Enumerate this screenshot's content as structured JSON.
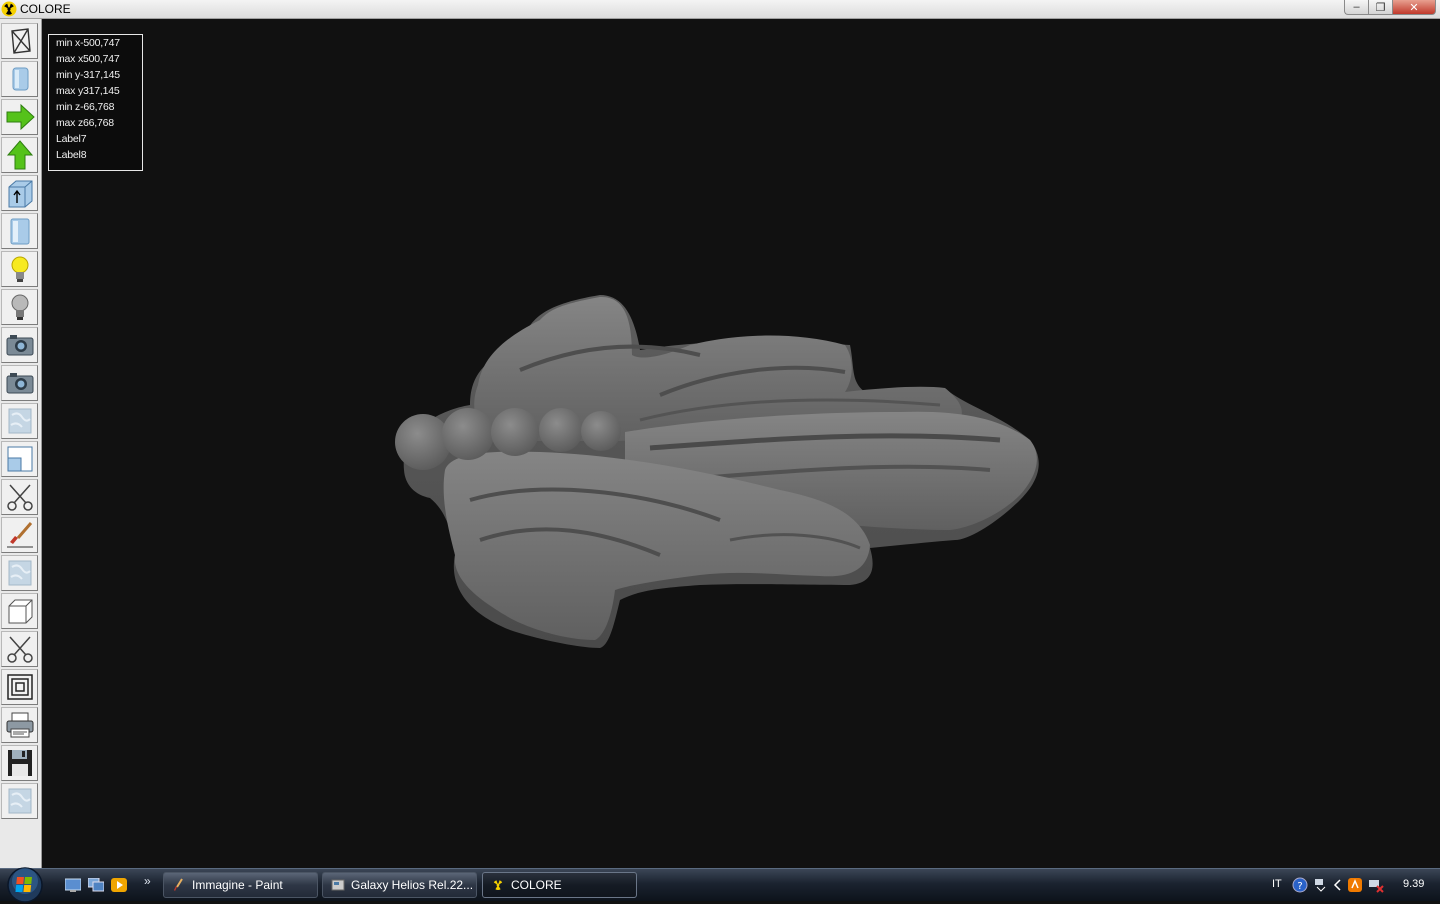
{
  "window": {
    "title": "COLORE",
    "controls": {
      "minimize": "‒",
      "maximize": "❐",
      "close": "✕"
    }
  },
  "toolbar": {
    "buttons": [
      {
        "icon": "wireframe-box-icon"
      },
      {
        "icon": "cylinder-icon"
      },
      {
        "icon": "green-arrow-right-icon"
      },
      {
        "icon": "green-arrow-up-icon"
      },
      {
        "icon": "cube-arrow-icon"
      },
      {
        "icon": "cylinder-blue-icon"
      },
      {
        "icon": "lightbulb-on-icon"
      },
      {
        "icon": "lightbulb-off-icon"
      },
      {
        "icon": "camera-icon"
      },
      {
        "icon": "camera-icon"
      },
      {
        "icon": "texture-icon"
      },
      {
        "icon": "window-view-icon"
      },
      {
        "icon": "scissors-icon"
      },
      {
        "icon": "paintbrush-icon"
      },
      {
        "icon": "texture-icon"
      },
      {
        "icon": "box-icon"
      },
      {
        "icon": "scissors-icon"
      },
      {
        "icon": "concentric-squares-icon"
      },
      {
        "icon": "printer-icon"
      },
      {
        "icon": "floppy-disk-icon"
      },
      {
        "icon": "texture-icon"
      }
    ]
  },
  "info": {
    "min_x": "min x-500,747",
    "max_x": "max x500,747",
    "min_y": "min y-317,145",
    "max_y": "max y317,145",
    "min_z": "min z-66,768",
    "max_z": "max z66,768",
    "label7": "Label7",
    "label8": "Label8"
  },
  "taskbar": {
    "more": "»",
    "tasks": [
      {
        "label": "Immagine - Paint",
        "icon": "paint-icon"
      },
      {
        "label": "Galaxy Helios  Rel.22...",
        "icon": "galaxy-icon"
      },
      {
        "label": "COLORE",
        "icon": "radiation-icon"
      }
    ],
    "tray": {
      "language": "IT",
      "clock": "9.39"
    }
  },
  "colors": {
    "viewport_bg": "#111111",
    "model_gray": "#6e6e6e"
  }
}
